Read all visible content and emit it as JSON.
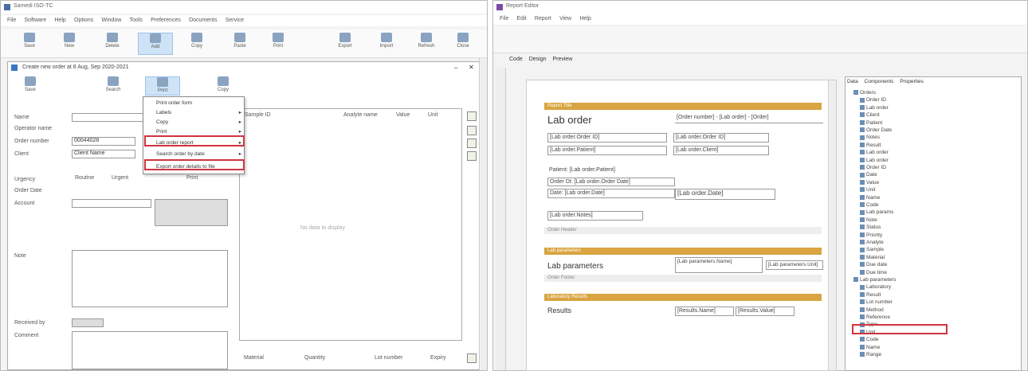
{
  "left_window": {
    "title": "Samedi ISO-TC",
    "menu": [
      "File",
      "Software",
      "Help",
      "Options",
      "Window",
      "Tools",
      "Preferences",
      "Documents",
      "Service",
      "Help"
    ],
    "ribbon": [
      "Save",
      "New",
      "Delete",
      "Add",
      "Copy",
      "Paste",
      "Print",
      "Export",
      "Import",
      "Refresh",
      "Close"
    ],
    "dialog_title": "Create new order at 8 Aug, Sep 2020-2021",
    "dialog_tabs": [
      "Save",
      "Search",
      "Print",
      "Copy"
    ],
    "form": {
      "name_label": "Name",
      "owner_label": "Operator name",
      "order_no_label": "Order number",
      "order_no_value": "00044028",
      "client_label": "Client",
      "client_value": "Client Name",
      "priority_label": "Urgency",
      "priority_opt1": "Routine",
      "priority_opt2": "Urgent",
      "priority_opt3": "Print",
      "due_label": "Order Date",
      "account_label": "Account",
      "notes_label": "Note",
      "recv_label": "Received by",
      "comment_label": "Comment"
    },
    "results_cols": [
      "Sample ID",
      "Analyte name",
      "Value",
      "Unit"
    ],
    "results_empty": "No data to display",
    "bottom_cols": [
      "Material",
      "Quantity",
      "Lot number",
      "Expiry"
    ],
    "menu_items": [
      "Print order form",
      "Labels",
      "Copy",
      "Print",
      "Lab order report",
      "Search order by date",
      "Export order details to file"
    ]
  },
  "right_window": {
    "title": "Report Editor",
    "menu": [
      "File",
      "Edit",
      "Report",
      "View",
      "Help"
    ],
    "tabs": [
      "Code",
      "Design",
      "Preview"
    ],
    "doc": {
      "band1": "Report Title",
      "title": "Lab order",
      "order_ref": "[Order number] - [Lab order] - [Order]",
      "line1": "[Lab order.Order ID]",
      "line1b": "[Lab order.Order ID]",
      "line2": "[Lab order.Patient]",
      "line2b": "[Lab order.Client]",
      "p1": "Patient: [Lab order.Patient]",
      "p2": "Order Dt: [Lab order.Order Date]",
      "p3": "Date: [Lab order.Date]",
      "p3b": "[Lab order.Date]",
      "p4": "[Lab order.Notes]",
      "band2": "Order Header",
      "band3": "Lab parameters",
      "param": "Lab parameters",
      "param_a": "[Lab parameters.Name]",
      "param_b": "[Lab parameters.Value]",
      "param_c": "[Lab parameters.Unit]",
      "band4": "Order Footer",
      "band5": "Laboratory Results",
      "result": "Results",
      "result_a": "[Results.Name]",
      "result_b": "[Results.Value]"
    },
    "tree_tabs": [
      "Data",
      "Components",
      "Properties"
    ],
    "tree_items": [
      "Orders",
      "Order ID",
      "Lab order",
      "Client",
      "Patient",
      "Order Date",
      "Notes",
      "Result",
      "Lab order",
      "Lab order",
      "Order ID",
      "Date",
      "Value",
      "Unit",
      "Name",
      "Code",
      "Lab params",
      "Note",
      "Status",
      "Priority",
      "Analyte",
      "Sample",
      "Material",
      "Due date",
      "Due time",
      "Lab parameters",
      "Laboratory",
      "Result",
      "Lot number",
      "Method",
      "Reference",
      "Type",
      "Unit",
      "Code",
      "Name",
      "Range"
    ]
  }
}
